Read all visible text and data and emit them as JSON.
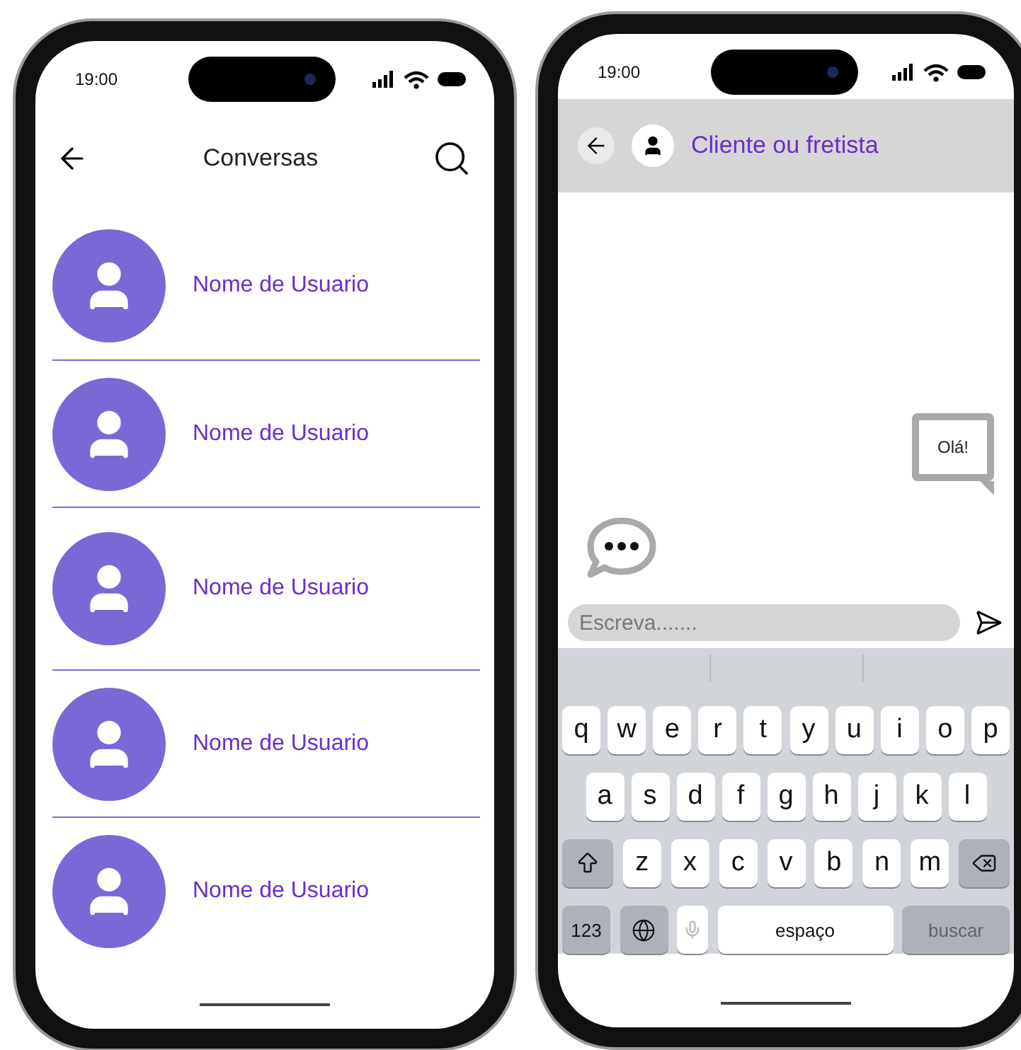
{
  "conversations_screen": {
    "status_bar": {
      "time": "19:00"
    },
    "header": {
      "title": "Conversas"
    },
    "conversations": [
      {
        "name": "Nome de Usuario"
      },
      {
        "name": "Nome de Usuario"
      },
      {
        "name": "Nome de Usuario"
      },
      {
        "name": "Nome de Usuario"
      },
      {
        "name": "Nome de Usuario"
      }
    ]
  },
  "chat_screen": {
    "status_bar": {
      "time": "19:00"
    },
    "header": {
      "title": "Cliente ou fretista"
    },
    "messages": [
      {
        "text": "Olá!",
        "outgoing": true
      }
    ],
    "typing": true,
    "composer": {
      "placeholder": "Escreva......."
    },
    "keyboard": {
      "rows": [
        {
          "keys": [
            {
              "kind": "letter",
              "label": "q"
            },
            {
              "kind": "letter",
              "label": "w"
            },
            {
              "kind": "letter",
              "label": "e"
            },
            {
              "kind": "letter",
              "label": "r"
            },
            {
              "kind": "letter",
              "label": "t"
            },
            {
              "kind": "letter",
              "label": "y"
            },
            {
              "kind": "letter",
              "label": "u"
            },
            {
              "kind": "letter",
              "label": "i"
            },
            {
              "kind": "letter",
              "label": "o"
            },
            {
              "kind": "letter",
              "label": "p"
            }
          ]
        },
        {
          "keys": [
            {
              "kind": "letter",
              "label": "a"
            },
            {
              "kind": "letter",
              "label": "s"
            },
            {
              "kind": "letter",
              "label": "d"
            },
            {
              "kind": "letter",
              "label": "f"
            },
            {
              "kind": "letter",
              "label": "g"
            },
            {
              "kind": "letter",
              "label": "h"
            },
            {
              "kind": "letter",
              "label": "j"
            },
            {
              "kind": "letter",
              "label": "k"
            },
            {
              "kind": "letter",
              "label": "l"
            }
          ]
        },
        {
          "keys": [
            {
              "kind": "shift"
            },
            {
              "kind": "letter",
              "label": "z"
            },
            {
              "kind": "letter",
              "label": "x"
            },
            {
              "kind": "letter",
              "label": "c"
            },
            {
              "kind": "letter",
              "label": "v"
            },
            {
              "kind": "letter",
              "label": "b"
            },
            {
              "kind": "letter",
              "label": "n"
            },
            {
              "kind": "letter",
              "label": "m"
            },
            {
              "kind": "delete"
            }
          ]
        },
        {
          "keys": [
            {
              "kind": "numbers",
              "label": "123"
            },
            {
              "kind": "globe"
            },
            {
              "kind": "mic"
            },
            {
              "kind": "space",
              "label": "espaço"
            },
            {
              "kind": "action",
              "label": "buscar",
              "disabled": true
            }
          ]
        }
      ]
    }
  }
}
